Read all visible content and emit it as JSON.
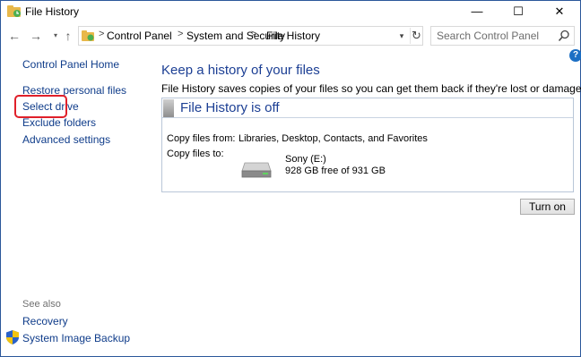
{
  "window": {
    "title": "File History",
    "minimize_glyph": "—",
    "maximize_glyph": "☐",
    "close_glyph": "✕"
  },
  "nav": {
    "back_glyph": "←",
    "forward_glyph": "→",
    "recent_glyph": "▾",
    "up_glyph": "↑",
    "breadcrumbs": [
      "Control Panel",
      "System and Security",
      "File History"
    ],
    "separator": ">",
    "search_placeholder": "Search Control Panel"
  },
  "help": {
    "glyph": "?"
  },
  "sidebar": {
    "home": "Control Panel Home",
    "items": [
      "Restore personal files",
      "Select drive",
      "Exclude folders",
      "Advanced settings"
    ],
    "highlighted_item": "Select drive",
    "highlight_color": "#e0202a",
    "see_also_heading": "See also",
    "see_also": [
      "Recovery",
      "System Image Backup"
    ]
  },
  "main": {
    "title": "Keep a history of your files",
    "description": "File History saves copies of your files so you can get them back if they're lost or damaged.",
    "status_title": "File History is off",
    "copy_from_label": "Copy files from:",
    "copy_from_value": "Libraries, Desktop, Contacts, and Favorites",
    "copy_to_label": "Copy files to:",
    "drive_name": "Sony (E:)",
    "drive_space": "928 GB free of 931 GB",
    "turn_on_label": "Turn on"
  },
  "colors": {
    "link": "#0f3c8a",
    "heading": "#1c3f94",
    "window_border": "#2b579a"
  }
}
